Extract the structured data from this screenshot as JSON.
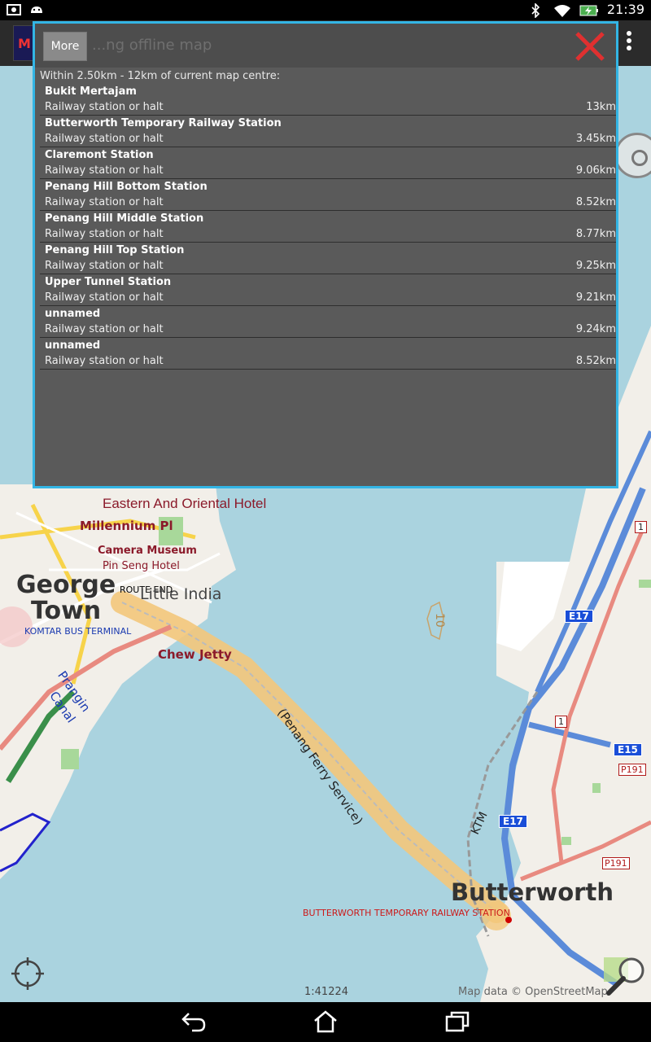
{
  "status_bar": {
    "time": "21:39",
    "icons": [
      "photo-icon",
      "android-icon",
      "bluetooth-icon",
      "wifi-icon",
      "battery-charging-icon"
    ]
  },
  "app_bar": {
    "logo_text": "M",
    "overflow_icon": "overflow-menu-icon"
  },
  "dialog": {
    "more_label": "More",
    "title": "...ng offline map",
    "close_icon": "close-icon",
    "subtitle": "Within 2.50km - 12km of current map centre:",
    "results": [
      {
        "name": "Bukit Mertajam",
        "type": "Railway station or halt",
        "distance": "13km"
      },
      {
        "name": "Butterworth Temporary Railway Station",
        "type": "Railway station or halt",
        "distance": "3.45km"
      },
      {
        "name": "Claremont Station",
        "type": "Railway station or halt",
        "distance": "9.06km"
      },
      {
        "name": "Penang Hill Bottom Station",
        "type": "Railway station or halt",
        "distance": "8.52km"
      },
      {
        "name": "Penang Hill Middle Station",
        "type": "Railway station or halt",
        "distance": "8.77km"
      },
      {
        "name": "Penang Hill Top Station",
        "type": "Railway station or halt",
        "distance": "9.25km"
      },
      {
        "name": "Upper Tunnel Station",
        "type": "Railway station or halt",
        "distance": "9.21km"
      },
      {
        "name": "unnamed",
        "type": "Railway station or halt",
        "distance": "9.24km"
      },
      {
        "name": "unnamed",
        "type": "Railway station or halt",
        "distance": "8.52km"
      }
    ]
  },
  "map": {
    "labels": {
      "eastern_oriental": "Eastern And Oriental Hotel",
      "millennium": "Millennium Pl",
      "camera_museum": "Camera Museum",
      "pin_seng": "Pin Seng Hotel",
      "george": "George",
      "town": "Town",
      "route_end": "ROUTE END",
      "little_india": "Little India",
      "komtar": "KOMTAR BUS TERMINAL",
      "chew_jetty": "Chew Jetty",
      "prangin": "Prangin",
      "canal": "Canal",
      "ferry": "(Penang Ferry Service)",
      "ktm": "KTM",
      "butterworth": "Butterworth",
      "butterworth_station": "BUTTERWORTH TEMPORARY RAILWAY STATION",
      "e17_a": "E17",
      "e17_b": "E17",
      "e15": "E15",
      "p191_a": "P191",
      "p191_b": "P191",
      "route1_a": "1",
      "route1_b": "1",
      "contour_10": "10"
    },
    "scale": "1:41224",
    "attribution": "Map data © OpenStreetMap"
  },
  "nav_bar": {
    "icons": [
      "back-icon",
      "home-icon",
      "recent-apps-icon"
    ]
  },
  "colors": {
    "dialog_border": "#33b5e5",
    "water": "#aad3df",
    "land": "#f2efe9",
    "close_red": "#e03030"
  }
}
